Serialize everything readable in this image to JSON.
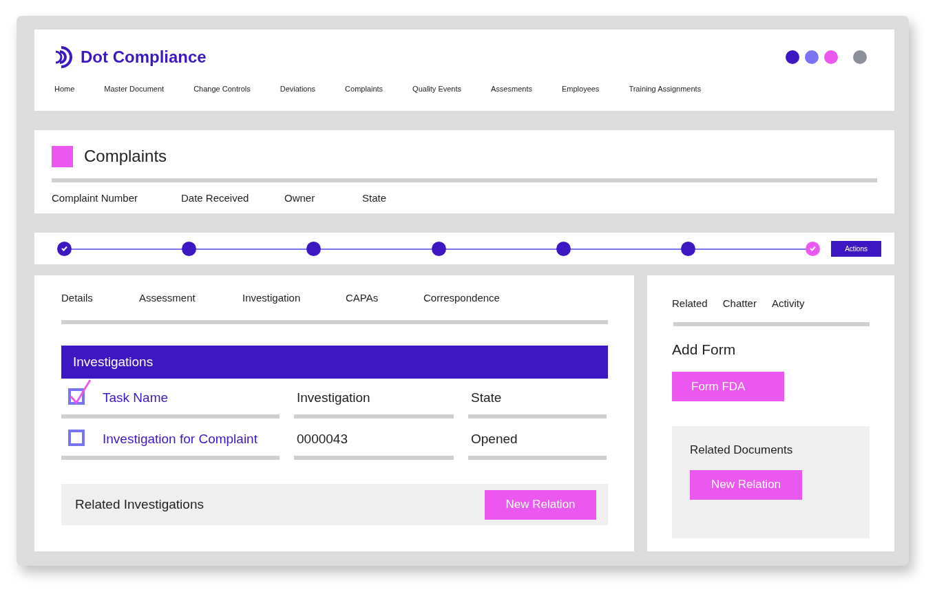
{
  "brand": {
    "name": "Dot Compliance"
  },
  "header_dots": [
    {
      "color": "#3d17c2"
    },
    {
      "color": "#7b74f2"
    },
    {
      "color": "#eb58ef"
    }
  ],
  "nav": [
    "Home",
    "Master Document",
    "Change Controls",
    "Deviations",
    "Complaints",
    "Quality Events",
    "Assesments",
    "Employees",
    "Training Assignments"
  ],
  "record": {
    "title": "Complaints",
    "fields": [
      "Complaint Number",
      "Date Received",
      "Owner",
      "State"
    ]
  },
  "stepper": {
    "steps": [
      {
        "done": true,
        "color": "#3d17c2"
      },
      {
        "done": false,
        "color": "#3d17c2"
      },
      {
        "done": false,
        "color": "#3d17c2"
      },
      {
        "done": false,
        "color": "#3d17c2"
      },
      {
        "done": false,
        "color": "#3d17c2"
      },
      {
        "done": false,
        "color": "#3d17c2"
      },
      {
        "done": true,
        "color": "#eb58ef"
      }
    ],
    "action": "Actions"
  },
  "tabs": [
    {
      "label": "Details"
    },
    {
      "label": "Assessment"
    },
    {
      "label": "Investigation"
    },
    {
      "label": "CAPAs"
    },
    {
      "label": "Correspondence"
    }
  ],
  "investigations": {
    "title": "Investigations",
    "columns": [
      {
        "label": "Task Name",
        "checked": true
      },
      {
        "label": "Investigation"
      },
      {
        "label": "State"
      }
    ],
    "rows": [
      {
        "checked": false,
        "task": "Investigation for Complaint",
        "investigation": "0000043",
        "state": "Opened"
      }
    ],
    "related_title": "Related Investigations",
    "related_button": "New Relation"
  },
  "side": {
    "tabs": [
      "Related",
      "Chatter",
      "Activity"
    ],
    "add_form_title": "Add Form",
    "form_button": "Form FDA",
    "docs_title": "Related Documents",
    "docs_button": "New Relation"
  }
}
